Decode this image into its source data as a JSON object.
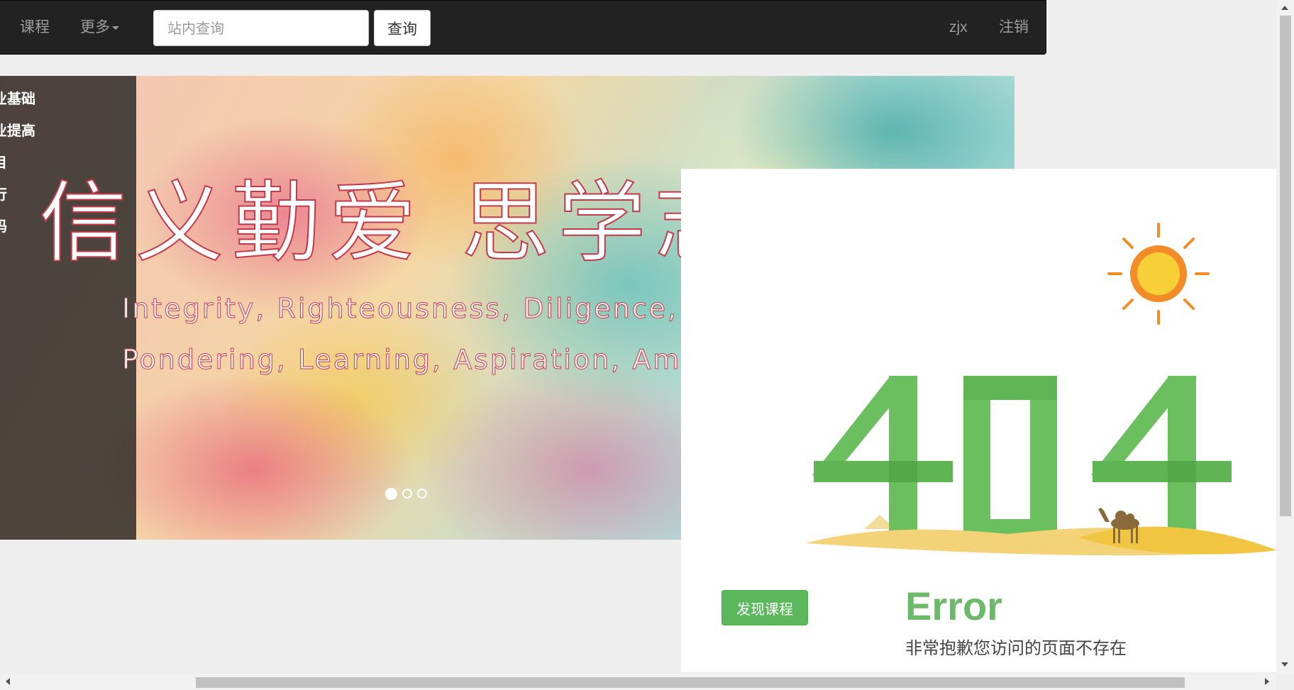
{
  "navbar": {
    "course_label": "课程",
    "more_label": "更多",
    "search_placeholder": "站内查询",
    "search_button": "查询",
    "username": "zjx",
    "logout_label": "注销"
  },
  "side_menu": {
    "items": [
      {
        "label": "业基础"
      },
      {
        "label": "业提高"
      },
      {
        "label": "目"
      },
      {
        "label": "行"
      },
      {
        "label": "码"
      }
    ]
  },
  "carousel": {
    "slogan_cn": "信义勤爱  思学志",
    "slogan_en_line1": "Integrity,  Righteousness,  Diligence,  Love",
    "slogan_en_line2": "Pondering,  Learning,  Aspiration,  Ambition",
    "slide_count": 3,
    "active_slide": 1
  },
  "error_panel": {
    "code": "404",
    "title": "Error",
    "message": "非常抱歉您访问的页面不存在",
    "discover_button": "发现课程"
  },
  "colors": {
    "navbar_bg": "#222222",
    "nav_text": "#9d9d9d",
    "success_green": "#5cb85c",
    "digit_green": "#6cbf5f",
    "sand_yellow": "#f0c542",
    "sun_orange": "#f28c28"
  },
  "icons": [
    "caret-down-icon",
    "sun-icon",
    "camel-icon",
    "scroll-up-icon",
    "scroll-down-icon",
    "scroll-left-icon",
    "scroll-right-icon"
  ]
}
